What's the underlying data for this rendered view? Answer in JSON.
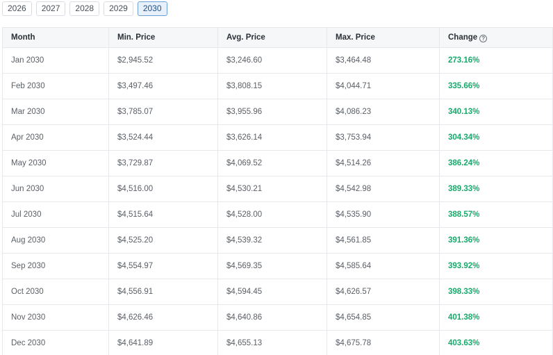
{
  "year_tabs": [
    {
      "label": "2026",
      "active": false
    },
    {
      "label": "2027",
      "active": false
    },
    {
      "label": "2028",
      "active": false
    },
    {
      "label": "2029",
      "active": false
    },
    {
      "label": "2030",
      "active": true
    }
  ],
  "table": {
    "headers": [
      "Month",
      "Min. Price",
      "Avg. Price",
      "Max. Price",
      "Change"
    ],
    "help_icon_glyph": "?",
    "rows": [
      [
        "Jan 2030",
        "$2,945.52",
        "$3,246.60",
        "$3,464.48",
        "273.16%"
      ],
      [
        "Feb 2030",
        "$3,497.46",
        "$3,808.15",
        "$4,044.71",
        "335.66%"
      ],
      [
        "Mar 2030",
        "$3,785.07",
        "$3,955.96",
        "$4,086.23",
        "340.13%"
      ],
      [
        "Apr 2030",
        "$3,524.44",
        "$3,626.14",
        "$3,753.94",
        "304.34%"
      ],
      [
        "May 2030",
        "$3,729.87",
        "$4,069.52",
        "$4,514.26",
        "386.24%"
      ],
      [
        "Jun 2030",
        "$4,516.00",
        "$4,530.21",
        "$4,542.98",
        "389.33%"
      ],
      [
        "Jul 2030",
        "$4,515.64",
        "$4,528.00",
        "$4,535.90",
        "388.57%"
      ],
      [
        "Aug 2030",
        "$4,525.20",
        "$4,539.32",
        "$4,561.85",
        "391.36%"
      ],
      [
        "Sep 2030",
        "$4,554.97",
        "$4,569.35",
        "$4,585.64",
        "393.92%"
      ],
      [
        "Oct 2030",
        "$4,556.91",
        "$4,594.45",
        "$4,626.57",
        "398.33%"
      ],
      [
        "Nov 2030",
        "$4,626.46",
        "$4,640.86",
        "$4,654.85",
        "401.38%"
      ],
      [
        "Dec 2030",
        "$4,641.89",
        "$4,655.13",
        "$4,675.78",
        "403.63%"
      ]
    ]
  },
  "colors": {
    "change_positive": "#1aa86b",
    "active_tab_border": "#6a9fd8",
    "active_tab_bg": "#e8f1fb"
  }
}
